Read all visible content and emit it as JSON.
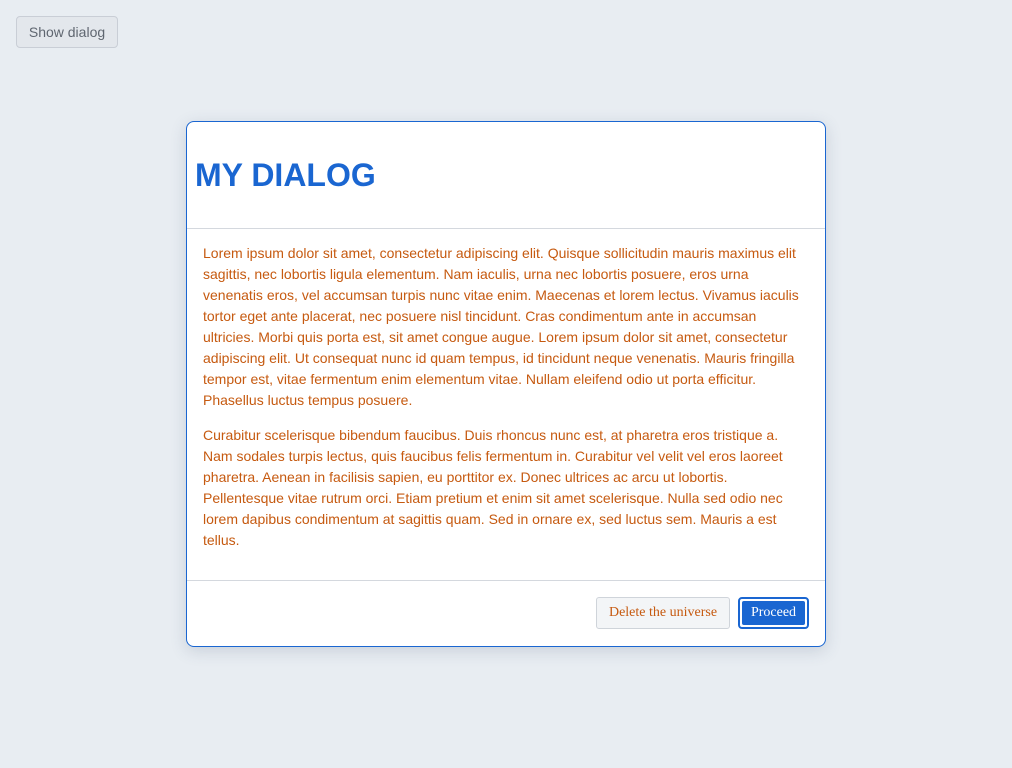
{
  "toolbar": {
    "show_dialog_label": "Show dialog"
  },
  "dialog": {
    "title": "MY DIALOG",
    "paragraphs": [
      "Lorem ipsum dolor sit amet, consectetur adipiscing elit. Quisque sollicitudin mauris maximus elit sagittis, nec lobortis ligula elementum. Nam iaculis, urna nec lobortis posuere, eros urna venenatis eros, vel accumsan turpis nunc vitae enim. Maecenas et lorem lectus. Vivamus iaculis tortor eget ante placerat, nec posuere nisl tincidunt. Cras condimentum ante in accumsan ultricies. Morbi quis porta est, sit amet congue augue. Lorem ipsum dolor sit amet, consectetur adipiscing elit. Ut consequat nunc id quam tempus, id tincidunt neque venenatis. Mauris fringilla tempor est, vitae fermentum enim elementum vitae. Nullam eleifend odio ut porta efficitur. Phasellus luctus tempus posuere.",
      "Curabitur scelerisque bibendum faucibus. Duis rhoncus nunc est, at pharetra eros tristique a. Nam sodales turpis lectus, quis faucibus felis fermentum in. Curabitur vel velit vel eros laoreet pharetra. Aenean in facilisis sapien, eu porttitor ex. Donec ultrices ac arcu ut lobortis. Pellentesque vitae rutrum orci. Etiam pretium et enim sit amet scelerisque. Nulla sed odio nec lorem dapibus condimentum at sagittis quam. Sed in ornare ex, sed luctus sem. Mauris a est tellus."
    ],
    "delete_label": "Delete the universe",
    "proceed_label": "Proceed"
  },
  "colors": {
    "accent": "#1a66d1",
    "body_text": "#c65a10",
    "page_background": "#e8edf2"
  }
}
